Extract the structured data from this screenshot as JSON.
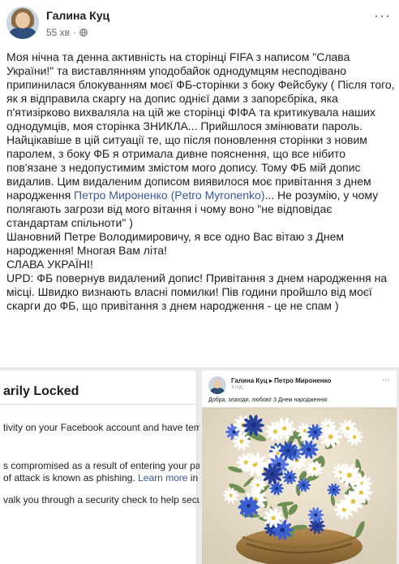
{
  "post": {
    "author": "Галина Куц",
    "time": "55 хв",
    "privacy_sep": "·",
    "more_label": "···"
  },
  "post_text": {
    "p1": "Моя нічна та денна активність на сторінці FIFA з написом \"Слава України!\" та виставлянням уподобайок однодумцям несподівано припинилася блокуванням моєї ФБ-сторінки з боку Фейсбуку ( Після того, як я відправила скаргу на допис однієї дами з запорєбріка, яка п'ятизірково вихваляла на цій же сторінці ФІФА та критикувала наших однодумців, моя сторінка ЗНИКЛА... Прийшлося змінювати пароль.",
    "p2_before": "Найцікавіше в цій ситуації те, що після поновлення сторінки з новим паролем, з боку ФБ я отримала дивне пояснення, що все нібито пов'язане з недопустимим змістом мого допису. Тому ФБ мій допис видалив. Цим видаленим дописом виявилося моє привітання з днем народження ",
    "p2_mention": "Петро Мироненко (Petro Myronenko)",
    "p2_after": "... Не розумію, у чому полягають загрози від мого вітання і чому воно \"не відповідає стандартам спільноти\" )",
    "p3": "Шановний Петре Володимировичу, я все одно Вас вітаю з Днем народження! Многая Вам літа!",
    "p4": "СЛАВА УКРАЇНІ!",
    "p5": "UPD: ФБ повернув видалений допис! Привітання з днем народження на місці. Швидко визнають власні помилки! Пів години пройшло від моєї скарги до ФБ, що привітання з днем народження - це не спам )"
  },
  "locked_screenshot": {
    "title": "arily Locked",
    "line1": "tivity on your Facebook account and have temporar",
    "line2": "s compromised as a result of entering your passwor",
    "line3_before": "of attack is known as phishing. ",
    "line3_link": "Learn more",
    "line3_after": " in the H",
    "line4": "valk you through a security check to help secure yo"
  },
  "birthday_screenshot": {
    "title": "Галина Куц ▸ Петро Мироненко",
    "time": "3 год.",
    "text": "Добра, злагоди, любові! З Днем народження!",
    "more_label": "···"
  },
  "colors": {
    "link": "#385898",
    "text": "#1c1e21",
    "meta": "#616770"
  }
}
